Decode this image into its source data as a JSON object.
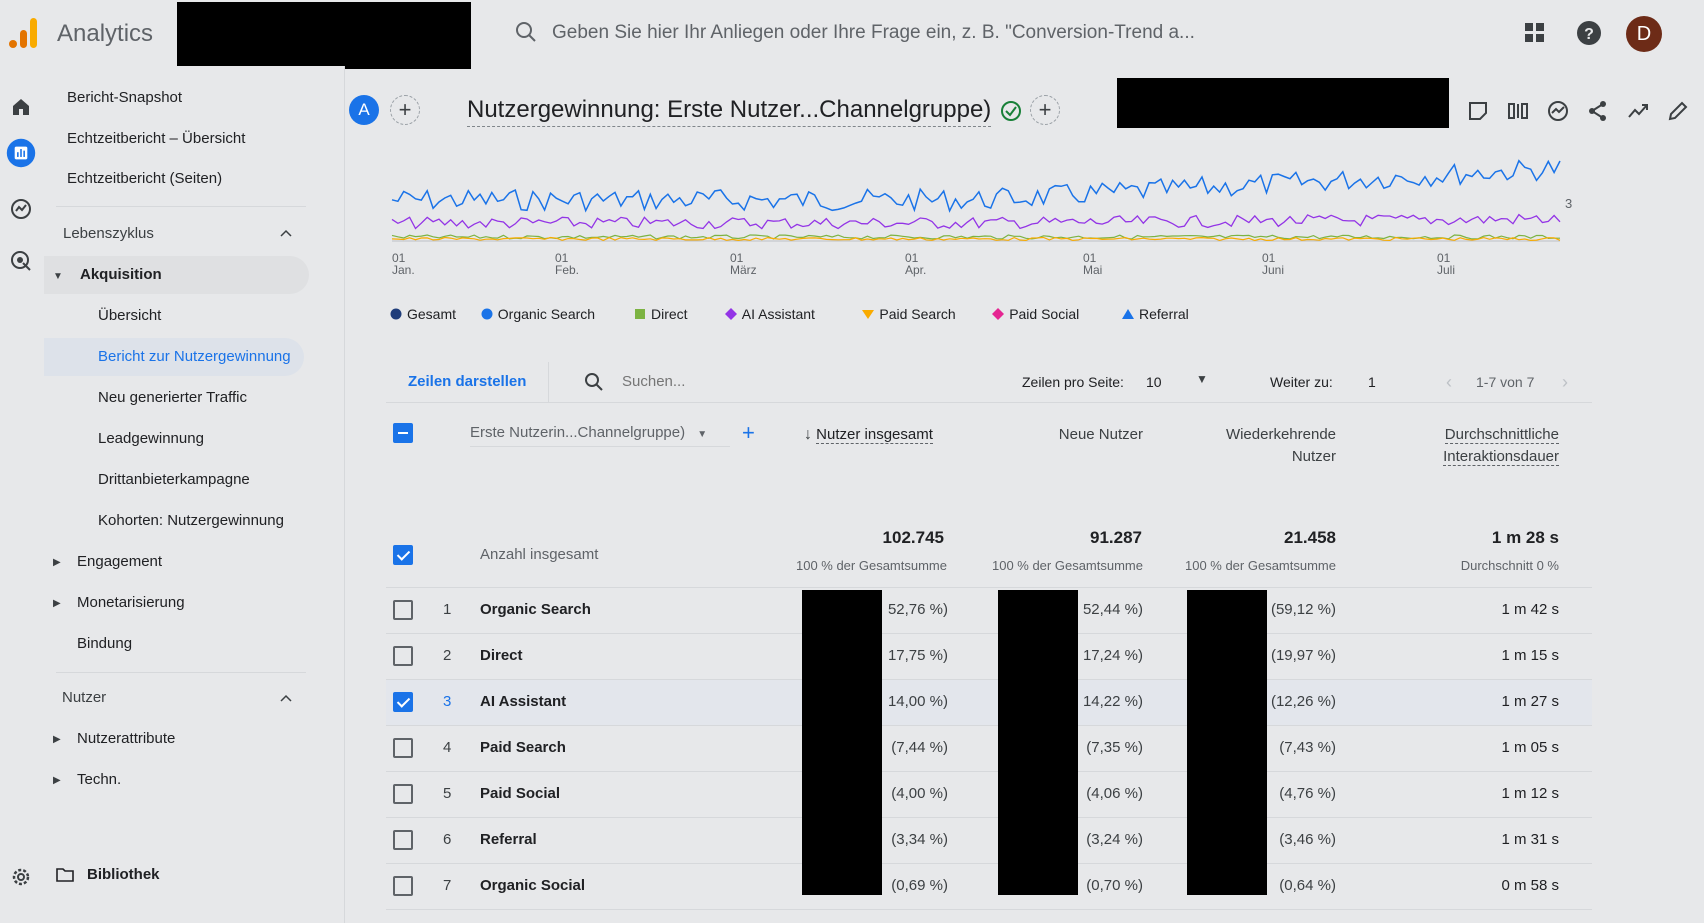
{
  "app": {
    "title": "Analytics",
    "avatar_letter": "D"
  },
  "search": {
    "placeholder": "Geben Sie hier Ihr Anliegen oder Ihre Frage ein, z. B. \"Conversion-Trend a..."
  },
  "sidebar": {
    "top_items": [
      "Bericht-Snapshot",
      "Echtzeitbericht – Übersicht",
      "Echtzeitbericht (Seiten)"
    ],
    "lifecycle_label": "Lebenszyklus",
    "acquisition_label": "Akquisition",
    "acquisition_items": [
      "Übersicht",
      "Bericht zur Nutzergewinnung",
      "Neu generierter Traffic",
      "Leadgewinnung",
      "Drittanbieterkampagne",
      "Kohorten: Nutzergewinnung"
    ],
    "lifecycle_items": [
      "Engagement",
      "Monetarisierung",
      "Bindung"
    ],
    "user_label": "Nutzer",
    "user_items": [
      "Nutzerattribute",
      "Techn."
    ],
    "library_label": "Bibliothek"
  },
  "header": {
    "comparison_letter": "A",
    "report_title": "Nutzergewinnung: Erste Nutzer...Channelgruppe)"
  },
  "chart": {
    "x_ticks": [
      {
        "day": "01",
        "month": "Jan."
      },
      {
        "day": "01",
        "month": "Feb."
      },
      {
        "day": "01",
        "month": "März"
      },
      {
        "day": "01",
        "month": "Apr."
      },
      {
        "day": "01",
        "month": "Mai"
      },
      {
        "day": "01",
        "month": "Juni"
      },
      {
        "day": "01",
        "month": "Juli"
      }
    ],
    "right_label": "3",
    "legend": [
      {
        "name": "Gesamt",
        "color": "#1f3d7a",
        "shape": "pin"
      },
      {
        "name": "Organic Search",
        "color": "#1a73e8",
        "shape": "circle"
      },
      {
        "name": "Direct",
        "color": "#7cb342",
        "shape": "square"
      },
      {
        "name": "AI Assistant",
        "color": "#9334e6",
        "shape": "diamond"
      },
      {
        "name": "Paid Search",
        "color": "#f9ab00",
        "shape": "triangle-down"
      },
      {
        "name": "Paid Social",
        "color": "#e52592",
        "shape": "diamond"
      },
      {
        "name": "Referral",
        "color": "#1a73e8",
        "shape": "triangle-up"
      }
    ]
  },
  "toolbar": {
    "rows_button": "Zeilen darstellen",
    "search_placeholder": "Suchen...",
    "rows_per_page_label": "Zeilen pro Seite:",
    "rows_per_page_value": "10",
    "goto_label": "Weiter zu:",
    "goto_value": "1",
    "pagination": "1-7 von 7"
  },
  "table": {
    "dimension_select": "Erste Nutzerin...Channelgruppe)",
    "columns": {
      "users": "Nutzer insgesamt",
      "new_users": "Neue Nutzer",
      "returning_1": "Wiederkehrende",
      "returning_2": "Nutzer",
      "duration_1": "Durchschnittliche",
      "duration_2": "Interaktionsdauer"
    },
    "totals": {
      "label": "Anzahl insgesamt",
      "users": "102.745",
      "users_sub": "100 % der Gesamtsumme",
      "new_users": "91.287",
      "new_users_sub": "100 % der Gesamtsumme",
      "returning": "21.458",
      "returning_sub": "100 % der Gesamtsumme",
      "duration": "1 m 28 s",
      "duration_sub": "Durchschnitt 0 %"
    },
    "rows": [
      {
        "idx": "1",
        "name": "Organic Search",
        "users_pct": "52,76 %)",
        "new_pct": "52,44 %)",
        "ret_pct": "(59,12 %)",
        "duration": "1 m 42 s",
        "checked": false
      },
      {
        "idx": "2",
        "name": "Direct",
        "users_pct": "17,75 %)",
        "new_pct": "17,24 %)",
        "ret_pct": "(19,97 %)",
        "duration": "1 m 15 s",
        "checked": false
      },
      {
        "idx": "3",
        "name": "AI Assistant",
        "users_pct": "14,00 %)",
        "new_pct": "14,22 %)",
        "ret_pct": "(12,26 %)",
        "duration": "1 m 27 s",
        "checked": true
      },
      {
        "idx": "4",
        "name": "Paid Search",
        "users_pct": "(7,44 %)",
        "new_pct": "(7,35 %)",
        "ret_pct": "(7,43 %)",
        "duration": "1 m 05 s",
        "checked": false
      },
      {
        "idx": "5",
        "name": "Paid Social",
        "users_pct": "(4,00 %)",
        "new_pct": "(4,06 %)",
        "ret_pct": "(4,76 %)",
        "duration": "1 m 12 s",
        "checked": false
      },
      {
        "idx": "6",
        "name": "Referral",
        "users_pct": "(3,34 %)",
        "new_pct": "(3,24 %)",
        "ret_pct": "(3,46 %)",
        "duration": "1 m 31 s",
        "checked": false
      },
      {
        "idx": "7",
        "name": "Organic Social",
        "users_pct": "(0,69 %)",
        "new_pct": "(0,70 %)",
        "ret_pct": "(0,64 %)",
        "duration": "0 m 58 s",
        "checked": false
      }
    ]
  }
}
